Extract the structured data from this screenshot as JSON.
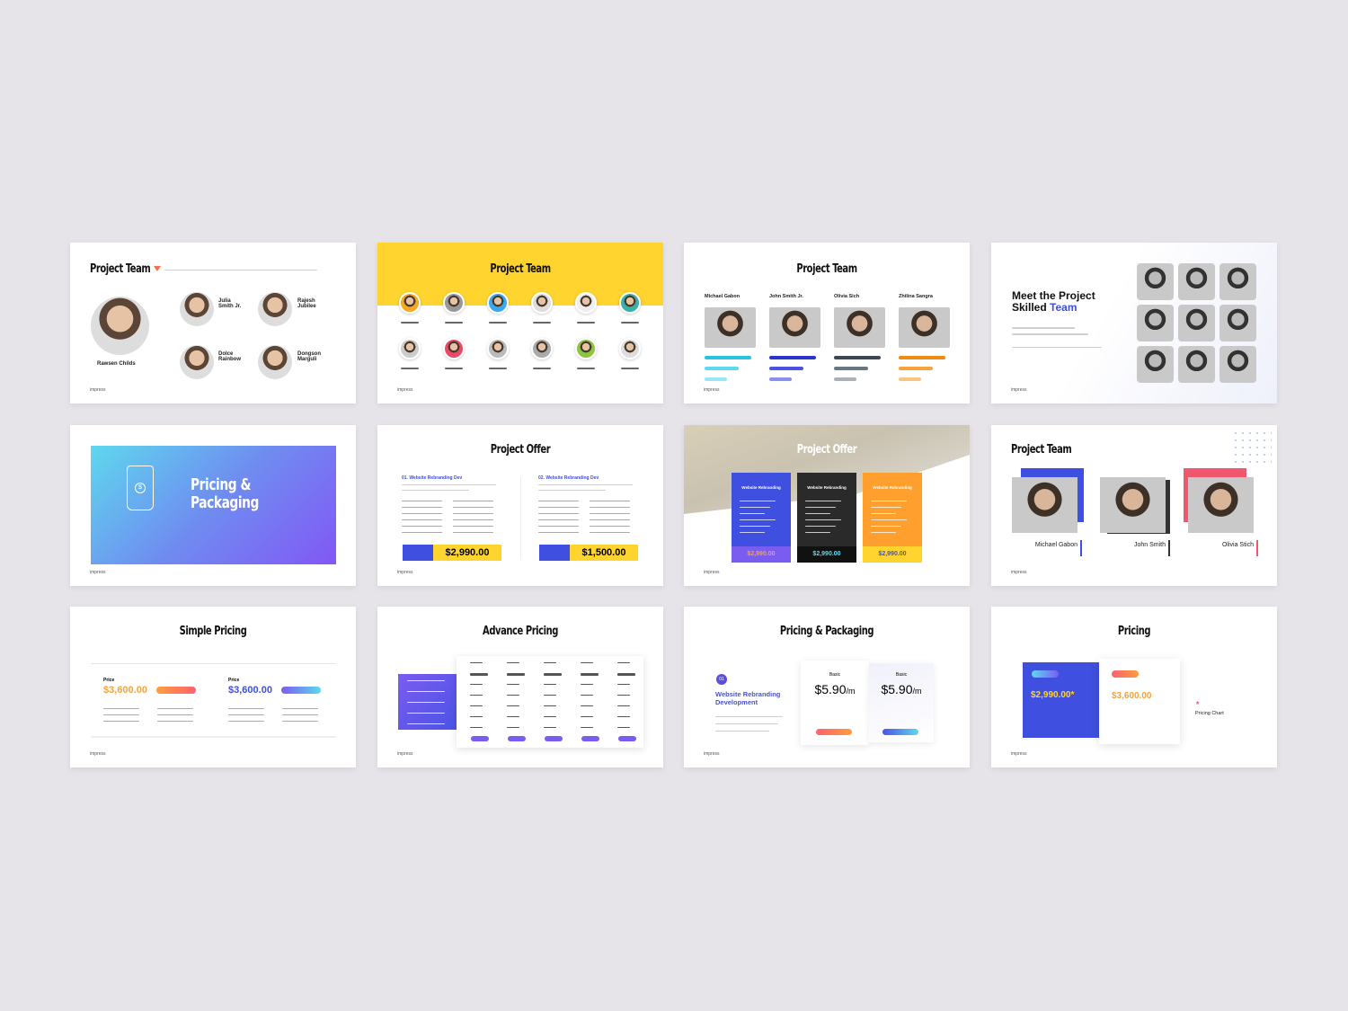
{
  "footer": "impress",
  "colors": {
    "background": "#e6e4e9",
    "yellow": "#ffd42e",
    "blue": "#3f4fe0",
    "purple": "#7b5cf0",
    "orange": "#ff9f2e",
    "coral": "#ff6b5b",
    "dark": "#222222"
  },
  "s1": {
    "title": "Project Team",
    "lead": "Rawsen Childs",
    "members": [
      "Julia Smith Jr.",
      "Rajesh Jubilee",
      "Dolce Rainbow",
      "Dongson Marguli"
    ]
  },
  "s2": {
    "title": "Project Team"
  },
  "s3": {
    "title": "Project Team",
    "members": [
      "Michael Gabon",
      "John Smith Jr.",
      "Olivia Sich",
      "Zhilina Sangra"
    ]
  },
  "s4": {
    "title1": "Meet the Project",
    "title2a": "Skilled ",
    "title2b": "Team"
  },
  "s5": {
    "title1": "Pricing &",
    "title2": "Packaging",
    "icon": "price-tag-dollar-icon"
  },
  "s6": {
    "title": "Project Offer",
    "col1": "01. Website Rebranding Dev",
    "col2": "02. Website Rebranding Dev",
    "price1": "$2,990.00",
    "price2": "$1,500.00"
  },
  "s7": {
    "title": "Project Offer",
    "cards": [
      {
        "label": "Website Rebranding",
        "price": "$2,990.00"
      },
      {
        "label": "Website Rebranding",
        "price": "$2,990.00"
      },
      {
        "label": "Website Rebranding",
        "price": "$2,990.00"
      }
    ]
  },
  "s8": {
    "title": "Project Team",
    "members": [
      "Michael Gabon",
      "John Smith",
      "Olivia Stich"
    ]
  },
  "s9": {
    "title": "Simple Pricing",
    "label": "Price",
    "price1": "$3,600.00",
    "price2": "$3,600.00"
  },
  "s10": {
    "title": "Advance Pricing"
  },
  "s11": {
    "title": "Pricing & Packaging",
    "badge": "01",
    "heading": "Website Rebranding Development",
    "plan": "Basic",
    "price1": "$5.90",
    "price2": "$5.90",
    "unit": "/m"
  },
  "s12": {
    "title": "Pricing",
    "price1": "$2,990.00*",
    "price2": "$3,600.00",
    "note": "Pricing Chart"
  }
}
